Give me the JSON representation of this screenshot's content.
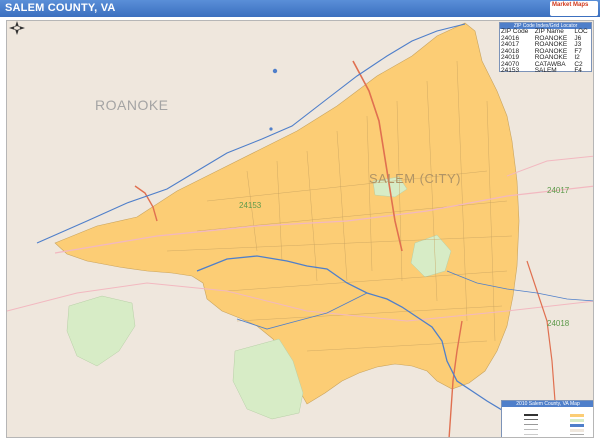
{
  "header": {
    "title": "SALEM COUNTY, VA",
    "logo_line1": "Market Maps",
    "logo_line2": "",
    "logo_line3": ""
  },
  "map": {
    "places": [
      {
        "name": "ROANOKE",
        "kind": "county"
      },
      {
        "name": "SALEM (CITY)",
        "kind": "city"
      }
    ],
    "zip_labels": [
      "24153",
      "24017",
      "24018"
    ]
  },
  "zip_table": {
    "caption": "ZIP Code Index/Grid Locator",
    "headers": [
      "ZIP Code",
      "ZIP Name",
      "LOC"
    ],
    "rows": [
      [
        "24016",
        "ROANOKE",
        "J6"
      ],
      [
        "24017",
        "ROANOKE",
        "J3"
      ],
      [
        "24018",
        "ROANOKE",
        "F7"
      ],
      [
        "24019",
        "ROANOKE",
        "I2"
      ],
      [
        "24070",
        "CATAWBA",
        "C2"
      ],
      [
        "24153",
        "SALEM",
        "F4"
      ]
    ]
  },
  "legend": {
    "caption": "2010 Salem County, VA Map",
    "subtitle": "",
    "left_items": [
      "",
      "",
      "",
      "",
      "",
      "",
      "",
      ""
    ],
    "right_items": [
      "",
      "",
      "",
      "",
      "",
      "",
      "",
      ""
    ]
  },
  "colors": {
    "salem_fill": "#fccd75",
    "land": "#efe7dd",
    "water": "#4f7fca",
    "park": "#d7ecc6",
    "interstate": "#e07050",
    "header": "#3b6fbf"
  }
}
